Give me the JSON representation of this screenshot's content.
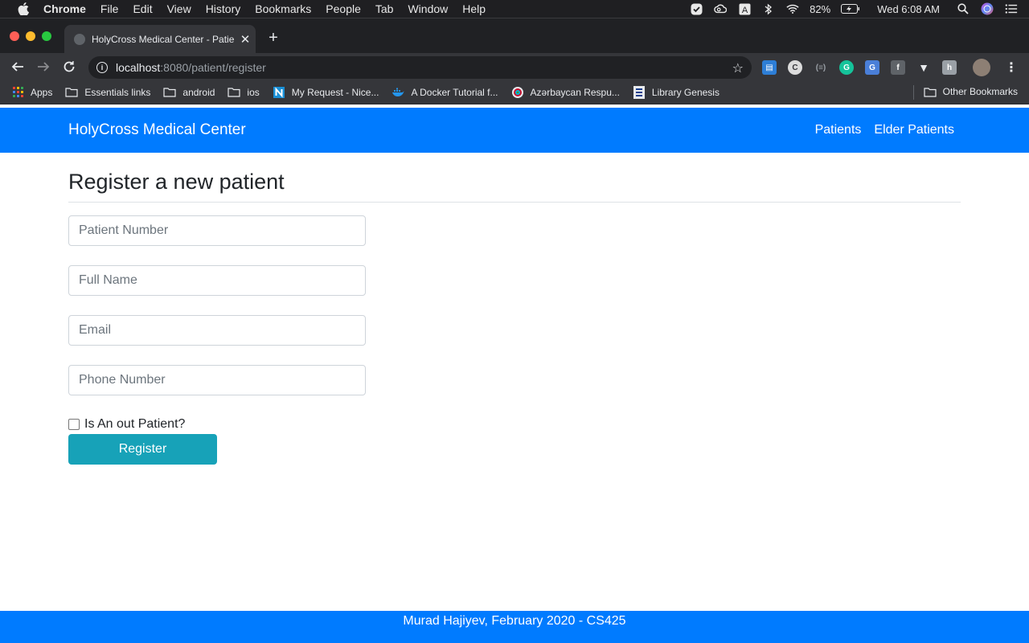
{
  "menubar": {
    "app_name": "Chrome",
    "items": [
      "File",
      "Edit",
      "View",
      "History",
      "Bookmarks",
      "People",
      "Tab",
      "Window",
      "Help"
    ],
    "battery": "82%",
    "clock": "Wed 6:08 AM",
    "status_icons": [
      "checkmark-icon",
      "creative-cloud-icon",
      "font-a-icon",
      "bluetooth-icon",
      "wifi-icon",
      "battery-charging-icon",
      "spotlight-search-icon",
      "siri-icon",
      "notification-center-icon"
    ]
  },
  "browser": {
    "tab_title": "HolyCross Medical Center - Patie",
    "url_host": "localhost",
    "url_path": ":8080/patient/register",
    "bookmarks": [
      {
        "label": "Apps",
        "icon": "apps-grid-icon"
      },
      {
        "label": "Essentials links",
        "icon": "folder-icon"
      },
      {
        "label": "android",
        "icon": "folder-icon"
      },
      {
        "label": "ios",
        "icon": "folder-icon"
      },
      {
        "label": "My Request - Nice...",
        "icon": "n-logo-icon"
      },
      {
        "label": "A Docker Tutorial f...",
        "icon": "docker-icon"
      },
      {
        "label": "Azərbaycan Respu...",
        "icon": "emblem-icon"
      },
      {
        "label": "Library Genesis",
        "icon": "library-icon"
      }
    ],
    "other_bookmarks": "Other Bookmarks"
  },
  "navbar": {
    "brand": "HolyCross Medical Center",
    "links": [
      "Patients",
      "Elder Patients"
    ]
  },
  "form": {
    "title": "Register a new patient",
    "fields": [
      {
        "placeholder": "Patient Number",
        "value": ""
      },
      {
        "placeholder": "Full Name",
        "value": ""
      },
      {
        "placeholder": "Email",
        "value": ""
      },
      {
        "placeholder": "Phone Number",
        "value": ""
      }
    ],
    "checkbox_label": "Is An out Patient?",
    "checkbox_checked": false,
    "submit_label": "Register"
  },
  "footer": {
    "text": "Murad Hajiyev, February 2020 - CS425"
  },
  "colors": {
    "primary": "#007bff",
    "info_button": "#17a2b8"
  }
}
